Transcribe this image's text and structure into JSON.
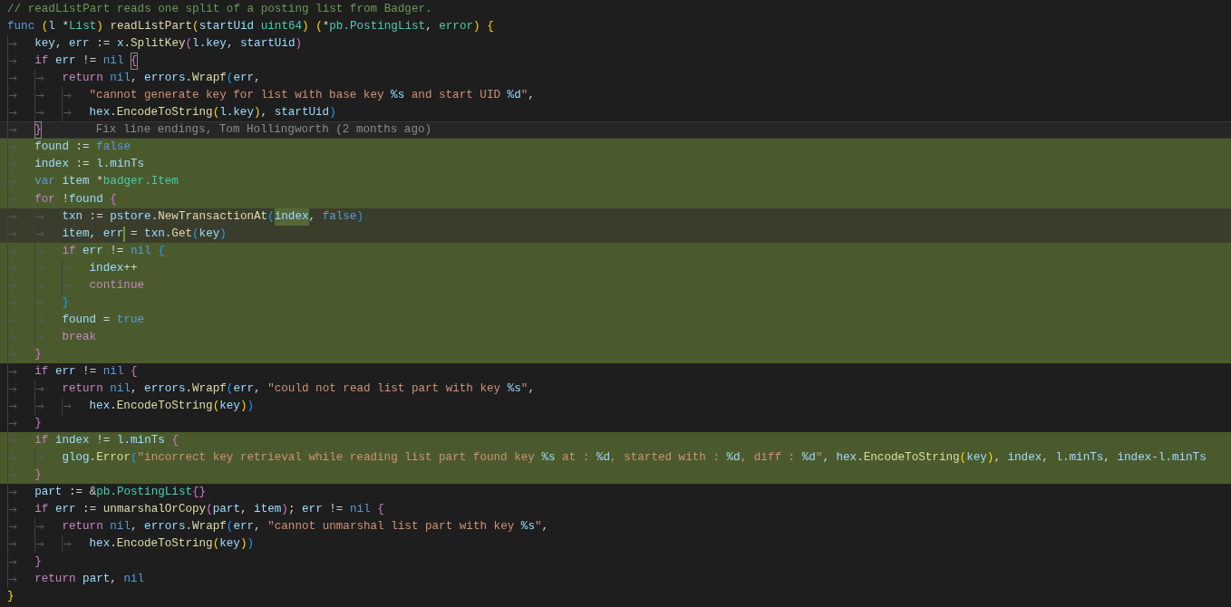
{
  "editor": {
    "lines": [
      {
        "highlighted": false,
        "current": false,
        "tokens": [
          {
            "kind": "comment",
            "text": "// readListPart reads one split of a posting list from Badger."
          }
        ]
      },
      {
        "highlighted": false,
        "current": false,
        "tokens": [
          {
            "kind": "keyword",
            "text": "func "
          },
          {
            "kind": "bracket1",
            "text": "("
          },
          {
            "kind": "var",
            "text": "l"
          },
          {
            "kind": "op",
            "text": " *"
          },
          {
            "kind": "type",
            "text": "List"
          },
          {
            "kind": "bracket1",
            "text": ") "
          },
          {
            "kind": "func",
            "text": "readListPart"
          },
          {
            "kind": "bracket1",
            "text": "("
          },
          {
            "kind": "var",
            "text": "startUid "
          },
          {
            "kind": "type",
            "text": "uint64"
          },
          {
            "kind": "bracket1",
            "text": ") ("
          },
          {
            "kind": "op",
            "text": "*"
          },
          {
            "kind": "type",
            "text": "pb.PostingList"
          },
          {
            "kind": "op",
            "text": ", "
          },
          {
            "kind": "type",
            "text": "error"
          },
          {
            "kind": "bracket1",
            "text": ") {"
          }
        ]
      },
      {
        "highlighted": false,
        "current": false,
        "tokens": [
          {
            "kind": "var",
            "text": "\tkey"
          },
          {
            "kind": "op",
            "text": ", "
          },
          {
            "kind": "var",
            "text": "err"
          },
          {
            "kind": "op",
            "text": " := "
          },
          {
            "kind": "var",
            "text": "x"
          },
          {
            "kind": "op",
            "text": "."
          },
          {
            "kind": "func",
            "text": "SplitKey"
          },
          {
            "kind": "bracket2",
            "text": "("
          },
          {
            "kind": "var",
            "text": "l.key"
          },
          {
            "kind": "op",
            "text": ", "
          },
          {
            "kind": "var",
            "text": "startUid"
          },
          {
            "kind": "bracket2",
            "text": ")"
          }
        ]
      },
      {
        "highlighted": false,
        "current": false,
        "tokens": [
          {
            "kind": "control",
            "text": "\tif "
          },
          {
            "kind": "var",
            "text": "err"
          },
          {
            "kind": "op",
            "text": " != "
          },
          {
            "kind": "keyword",
            "text": "nil "
          },
          {
            "kind": "bracket2",
            "text": "{",
            "matched": true
          }
        ]
      },
      {
        "highlighted": false,
        "current": false,
        "tokens": [
          {
            "kind": "control",
            "text": "\t\treturn "
          },
          {
            "kind": "keyword",
            "text": "nil"
          },
          {
            "kind": "op",
            "text": ", "
          },
          {
            "kind": "var",
            "text": "errors"
          },
          {
            "kind": "op",
            "text": "."
          },
          {
            "kind": "func",
            "text": "Wrapf"
          },
          {
            "kind": "bracket3",
            "text": "("
          },
          {
            "kind": "var",
            "text": "err"
          },
          {
            "kind": "op",
            "text": ","
          }
        ]
      },
      {
        "highlighted": false,
        "current": false,
        "tokens": [
          {
            "kind": "string",
            "text": "\t\t\t\"cannot generate key for list with base key "
          },
          {
            "kind": "format",
            "text": "%s"
          },
          {
            "kind": "string",
            "text": " and start UID "
          },
          {
            "kind": "format",
            "text": "%d"
          },
          {
            "kind": "string",
            "text": "\""
          },
          {
            "kind": "op",
            "text": ","
          }
        ]
      },
      {
        "highlighted": false,
        "current": false,
        "tokens": [
          {
            "kind": "var",
            "text": "\t\t\thex"
          },
          {
            "kind": "op",
            "text": "."
          },
          {
            "kind": "func",
            "text": "EncodeToString"
          },
          {
            "kind": "bracket1",
            "text": "("
          },
          {
            "kind": "var",
            "text": "l.key"
          },
          {
            "kind": "bracket1",
            "text": ")"
          },
          {
            "kind": "op",
            "text": ", "
          },
          {
            "kind": "var",
            "text": "startUid"
          },
          {
            "kind": "bracket3",
            "text": ")"
          }
        ]
      },
      {
        "highlighted": false,
        "current": false,
        "annotation": "Fix line endings, Tom Hollingworth (2 months ago)",
        "tokens": [
          {
            "kind": "bracket2",
            "text": "\t}",
            "matched": true
          }
        ]
      },
      {
        "highlighted": true,
        "current": false,
        "tokens": [
          {
            "kind": "var",
            "text": "\tfound"
          },
          {
            "kind": "op",
            "text": " := "
          },
          {
            "kind": "keyword",
            "text": "false"
          }
        ]
      },
      {
        "highlighted": true,
        "current": false,
        "tokens": [
          {
            "kind": "var",
            "text": "\tindex"
          },
          {
            "kind": "op",
            "text": " := "
          },
          {
            "kind": "var",
            "text": "l.minTs"
          }
        ]
      },
      {
        "highlighted": true,
        "current": false,
        "tokens": [
          {
            "kind": "keyword",
            "text": "\tvar "
          },
          {
            "kind": "var",
            "text": "item"
          },
          {
            "kind": "op",
            "text": " *"
          },
          {
            "kind": "type",
            "text": "badger.Item"
          }
        ]
      },
      {
        "highlighted": true,
        "current": false,
        "tokens": [
          {
            "kind": "control",
            "text": "\tfor"
          },
          {
            "kind": "op",
            "text": " !"
          },
          {
            "kind": "var",
            "text": "found "
          },
          {
            "kind": "bracket2",
            "text": "{"
          }
        ]
      },
      {
        "highlighted": true,
        "current": true,
        "tokens": [
          {
            "kind": "var",
            "text": "\t\ttxn"
          },
          {
            "kind": "op",
            "text": " := "
          },
          {
            "kind": "var",
            "text": "pstore"
          },
          {
            "kind": "op",
            "text": "."
          },
          {
            "kind": "func",
            "text": "NewTransactionAt"
          },
          {
            "kind": "bracket3",
            "text": "("
          },
          {
            "kind": "var",
            "text": "index",
            "word_match": true
          },
          {
            "kind": "op",
            "text": ", "
          },
          {
            "kind": "keyword",
            "text": "false"
          },
          {
            "kind": "bracket3",
            "text": ")"
          }
        ]
      },
      {
        "highlighted": true,
        "current": true,
        "tokens": [
          {
            "kind": "var",
            "text": "\t\titem"
          },
          {
            "kind": "op",
            "text": ", "
          },
          {
            "kind": "var",
            "text": "err ",
            "caret": true
          },
          {
            "kind": "op",
            "text": "= "
          },
          {
            "kind": "var",
            "text": "txn"
          },
          {
            "kind": "op",
            "text": "."
          },
          {
            "kind": "func",
            "text": "Get"
          },
          {
            "kind": "bracket3",
            "text": "("
          },
          {
            "kind": "var",
            "text": "key"
          },
          {
            "kind": "bracket3",
            "text": ")"
          }
        ]
      },
      {
        "highlighted": true,
        "current": false,
        "tokens": [
          {
            "kind": "control",
            "text": "\t\tif "
          },
          {
            "kind": "var",
            "text": "err"
          },
          {
            "kind": "op",
            "text": " != "
          },
          {
            "kind": "keyword",
            "text": "nil "
          },
          {
            "kind": "bracket3",
            "text": "{"
          }
        ]
      },
      {
        "highlighted": true,
        "current": false,
        "tokens": [
          {
            "kind": "var",
            "text": "\t\t\tindex"
          },
          {
            "kind": "op",
            "text": "++"
          }
        ]
      },
      {
        "highlighted": true,
        "current": false,
        "tokens": [
          {
            "kind": "control",
            "text": "\t\t\tcontinue"
          }
        ]
      },
      {
        "highlighted": true,
        "current": false,
        "tokens": [
          {
            "kind": "bracket3",
            "text": "\t\t}"
          }
        ]
      },
      {
        "highlighted": true,
        "current": false,
        "tokens": [
          {
            "kind": "var",
            "text": "\t\tfound"
          },
          {
            "kind": "op",
            "text": " = "
          },
          {
            "kind": "keyword",
            "text": "true"
          }
        ]
      },
      {
        "highlighted": true,
        "current": false,
        "tokens": [
          {
            "kind": "control",
            "text": "\t\tbreak"
          }
        ]
      },
      {
        "highlighted": true,
        "current": false,
        "tokens": [
          {
            "kind": "bracket2",
            "text": "\t}"
          }
        ]
      },
      {
        "highlighted": false,
        "current": false,
        "tokens": [
          {
            "kind": "control",
            "text": "\tif "
          },
          {
            "kind": "var",
            "text": "err"
          },
          {
            "kind": "op",
            "text": " != "
          },
          {
            "kind": "keyword",
            "text": "nil "
          },
          {
            "kind": "bracket2",
            "text": "{"
          }
        ]
      },
      {
        "highlighted": false,
        "current": false,
        "tokens": [
          {
            "kind": "control",
            "text": "\t\treturn "
          },
          {
            "kind": "keyword",
            "text": "nil"
          },
          {
            "kind": "op",
            "text": ", "
          },
          {
            "kind": "var",
            "text": "errors"
          },
          {
            "kind": "op",
            "text": "."
          },
          {
            "kind": "func",
            "text": "Wrapf"
          },
          {
            "kind": "bracket3",
            "text": "("
          },
          {
            "kind": "var",
            "text": "err"
          },
          {
            "kind": "op",
            "text": ", "
          },
          {
            "kind": "string",
            "text": "\"could not read list part with key "
          },
          {
            "kind": "format",
            "text": "%s"
          },
          {
            "kind": "string",
            "text": "\""
          },
          {
            "kind": "op",
            "text": ","
          }
        ]
      },
      {
        "highlighted": false,
        "current": false,
        "tokens": [
          {
            "kind": "var",
            "text": "\t\t\thex"
          },
          {
            "kind": "op",
            "text": "."
          },
          {
            "kind": "func",
            "text": "EncodeToString"
          },
          {
            "kind": "bracket1",
            "text": "("
          },
          {
            "kind": "var",
            "text": "key"
          },
          {
            "kind": "bracket1",
            "text": ")"
          },
          {
            "kind": "bracket3",
            "text": ")"
          }
        ]
      },
      {
        "highlighted": false,
        "current": false,
        "tokens": [
          {
            "kind": "bracket2",
            "text": "\t}"
          }
        ]
      },
      {
        "highlighted": true,
        "current": false,
        "tokens": [
          {
            "kind": "control",
            "text": "\tif "
          },
          {
            "kind": "var",
            "text": "index"
          },
          {
            "kind": "op",
            "text": " != "
          },
          {
            "kind": "var",
            "text": "l.minTs "
          },
          {
            "kind": "bracket2",
            "text": "{"
          }
        ]
      },
      {
        "highlighted": true,
        "current": false,
        "tokens": [
          {
            "kind": "var",
            "text": "\t\tglog"
          },
          {
            "kind": "op",
            "text": "."
          },
          {
            "kind": "func",
            "text": "Error"
          },
          {
            "kind": "bracket3",
            "text": "("
          },
          {
            "kind": "string",
            "text": "\"incorrect key retrieval while reading list part found key "
          },
          {
            "kind": "format",
            "text": "%s"
          },
          {
            "kind": "string",
            "text": " at : "
          },
          {
            "kind": "format",
            "text": "%d"
          },
          {
            "kind": "string",
            "text": ", started with : "
          },
          {
            "kind": "format",
            "text": "%d"
          },
          {
            "kind": "string",
            "text": ", diff : "
          },
          {
            "kind": "format",
            "text": "%d"
          },
          {
            "kind": "string",
            "text": "\""
          },
          {
            "kind": "op",
            "text": ", "
          },
          {
            "kind": "var",
            "text": "hex"
          },
          {
            "kind": "op",
            "text": "."
          },
          {
            "kind": "func",
            "text": "EncodeToString"
          },
          {
            "kind": "bracket1",
            "text": "("
          },
          {
            "kind": "var",
            "text": "key"
          },
          {
            "kind": "bracket1",
            "text": ")"
          },
          {
            "kind": "op",
            "text": ", "
          },
          {
            "kind": "var",
            "text": "index"
          },
          {
            "kind": "op",
            "text": ", "
          },
          {
            "kind": "var",
            "text": "l.minTs"
          },
          {
            "kind": "op",
            "text": ", "
          },
          {
            "kind": "var",
            "text": "index"
          },
          {
            "kind": "op",
            "text": "-"
          },
          {
            "kind": "var",
            "text": "l.minTs"
          }
        ]
      },
      {
        "highlighted": true,
        "current": false,
        "tokens": [
          {
            "kind": "bracket2",
            "text": "\t}"
          }
        ]
      },
      {
        "highlighted": false,
        "current": false,
        "tokens": [
          {
            "kind": "var",
            "text": "\tpart"
          },
          {
            "kind": "op",
            "text": " := &"
          },
          {
            "kind": "type",
            "text": "pb.PostingList"
          },
          {
            "kind": "bracket2",
            "text": "{}"
          }
        ]
      },
      {
        "highlighted": false,
        "current": false,
        "tokens": [
          {
            "kind": "control",
            "text": "\tif "
          },
          {
            "kind": "var",
            "text": "err"
          },
          {
            "kind": "op",
            "text": " := "
          },
          {
            "kind": "func",
            "text": "unmarshalOrCopy"
          },
          {
            "kind": "bracket2",
            "text": "("
          },
          {
            "kind": "var",
            "text": "part"
          },
          {
            "kind": "op",
            "text": ", "
          },
          {
            "kind": "var",
            "text": "item"
          },
          {
            "kind": "bracket2",
            "text": ")"
          },
          {
            "kind": "op",
            "text": "; "
          },
          {
            "kind": "var",
            "text": "err"
          },
          {
            "kind": "op",
            "text": " != "
          },
          {
            "kind": "keyword",
            "text": "nil "
          },
          {
            "kind": "bracket2",
            "text": "{"
          }
        ]
      },
      {
        "highlighted": false,
        "current": false,
        "tokens": [
          {
            "kind": "control",
            "text": "\t\treturn "
          },
          {
            "kind": "keyword",
            "text": "nil"
          },
          {
            "kind": "op",
            "text": ", "
          },
          {
            "kind": "var",
            "text": "errors"
          },
          {
            "kind": "op",
            "text": "."
          },
          {
            "kind": "func",
            "text": "Wrapf"
          },
          {
            "kind": "bracket3",
            "text": "("
          },
          {
            "kind": "var",
            "text": "err"
          },
          {
            "kind": "op",
            "text": ", "
          },
          {
            "kind": "string",
            "text": "\"cannot unmarshal list part with key "
          },
          {
            "kind": "format",
            "text": "%s"
          },
          {
            "kind": "string",
            "text": "\""
          },
          {
            "kind": "op",
            "text": ","
          }
        ]
      },
      {
        "highlighted": false,
        "current": false,
        "tokens": [
          {
            "kind": "var",
            "text": "\t\t\thex"
          },
          {
            "kind": "op",
            "text": "."
          },
          {
            "kind": "func",
            "text": "EncodeToString"
          },
          {
            "kind": "bracket1",
            "text": "("
          },
          {
            "kind": "var",
            "text": "key"
          },
          {
            "kind": "bracket1",
            "text": ")"
          },
          {
            "kind": "bracket3",
            "text": ")"
          }
        ]
      },
      {
        "highlighted": false,
        "current": false,
        "tokens": [
          {
            "kind": "bracket2",
            "text": "\t}"
          }
        ]
      },
      {
        "highlighted": false,
        "current": false,
        "tokens": [
          {
            "kind": "control",
            "text": "\treturn "
          },
          {
            "kind": "var",
            "text": "part"
          },
          {
            "kind": "op",
            "text": ", "
          },
          {
            "kind": "keyword",
            "text": "nil"
          }
        ]
      },
      {
        "highlighted": false,
        "current": false,
        "tokens": [
          {
            "kind": "bracket1",
            "text": "}"
          }
        ]
      }
    ]
  }
}
